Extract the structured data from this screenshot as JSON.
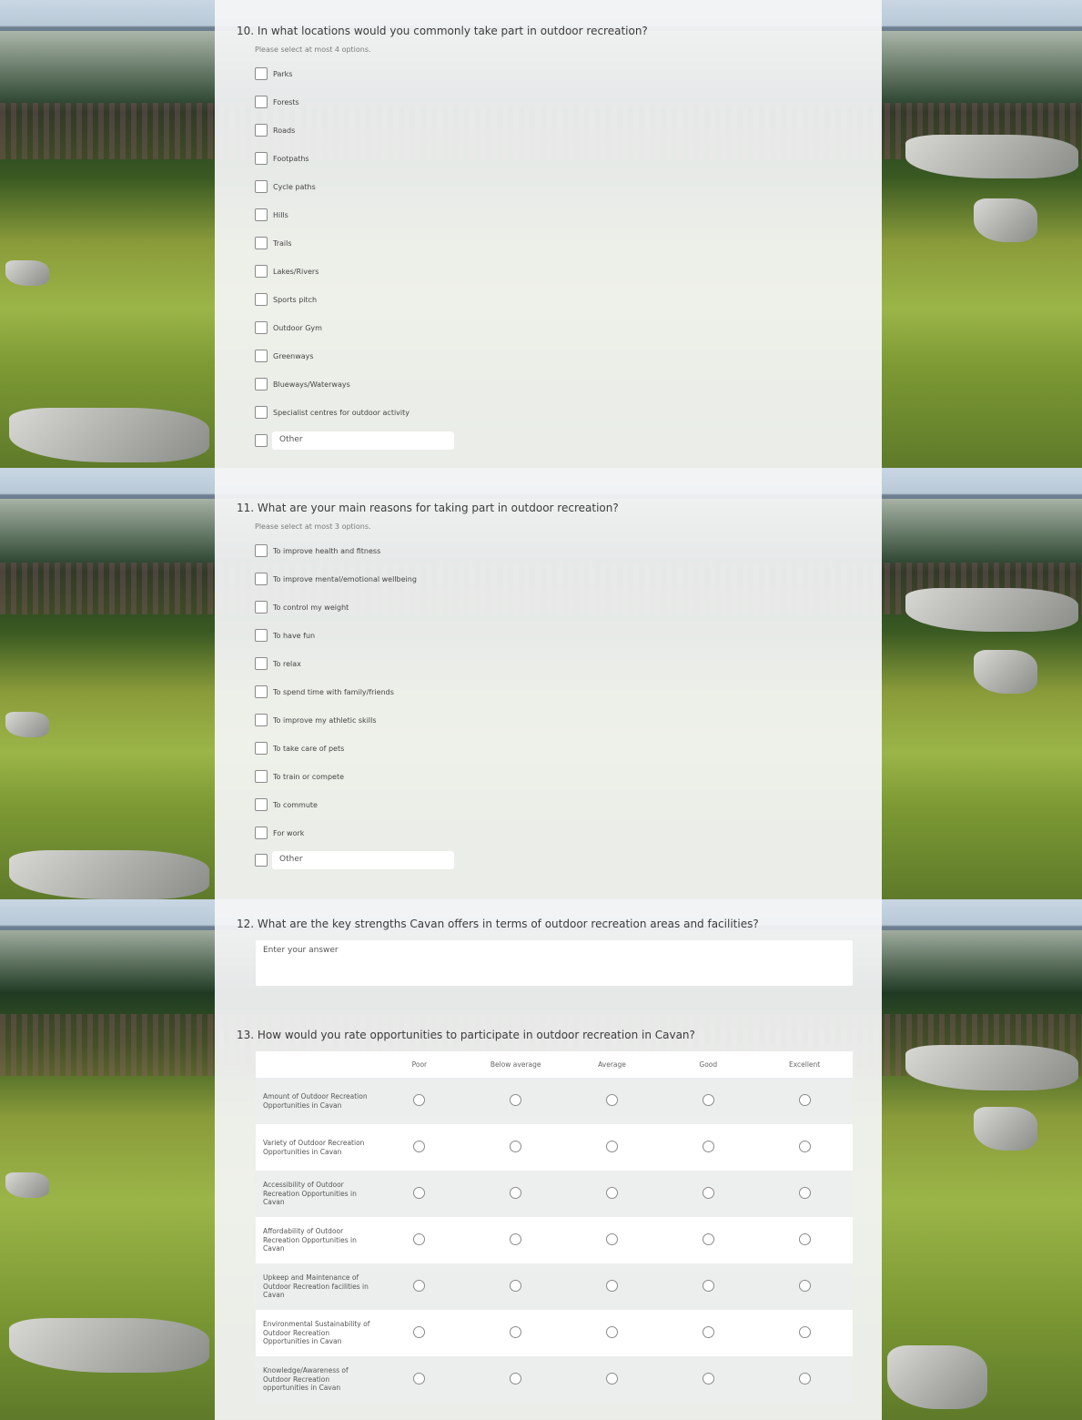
{
  "q10": {
    "title": "10. In what locations would you commonly take part in outdoor recreation?",
    "hint": "Please select at most 4 options.",
    "options": [
      "Parks",
      "Forests",
      "Roads",
      "Footpaths",
      "Cycle paths",
      "Hills",
      "Trails",
      "Lakes/Rivers",
      "Sports pitch",
      "Outdoor Gym",
      "Greenways",
      "Blueways/Waterways",
      "Specialist centres for outdoor activity"
    ],
    "other_placeholder": "Other"
  },
  "q11": {
    "title": "11. What are your main reasons for taking part in outdoor recreation?",
    "hint": "Please select at most 3 options.",
    "options": [
      "To improve health and fitness",
      "To improve mental/emotional wellbeing",
      "To control my weight",
      "To have fun",
      "To relax",
      "To spend time with family/friends",
      "To improve my athletic skills",
      "To take care of pets",
      "To train or compete",
      "To commute",
      "For work"
    ],
    "other_placeholder": "Other"
  },
  "q12": {
    "title": "12. What are the key strengths Cavan offers in terms of outdoor recreation areas and facilities?",
    "placeholder": "Enter your answer"
  },
  "q13": {
    "title": "13. How would you rate opportunities to participate in outdoor recreation in Cavan?",
    "columns": [
      "Poor",
      "Below average",
      "Average",
      "Good",
      "Excellent"
    ],
    "rows": [
      "Amount of Outdoor Recreation Opportunities in Cavan",
      "Variety of Outdoor Recreation Opportunities in Cavan",
      "Accessibility of Outdoor Recreation Opportunities in Cavan",
      "Affordability of Outdoor Recreation Opportunities in Cavan",
      "Upkeep and Maintenance of Outdoor Recreation facilities in Cavan",
      "Environmental Sustainability of Outdoor Recreation Opportunities in Cavan",
      "Knowledge/Awareness of Outdoor Recreation opportunities in Cavan"
    ]
  },
  "colors": {
    "card": "#f4f5f6",
    "text": "#3b3b3b",
    "border": "#8a8a8a"
  }
}
